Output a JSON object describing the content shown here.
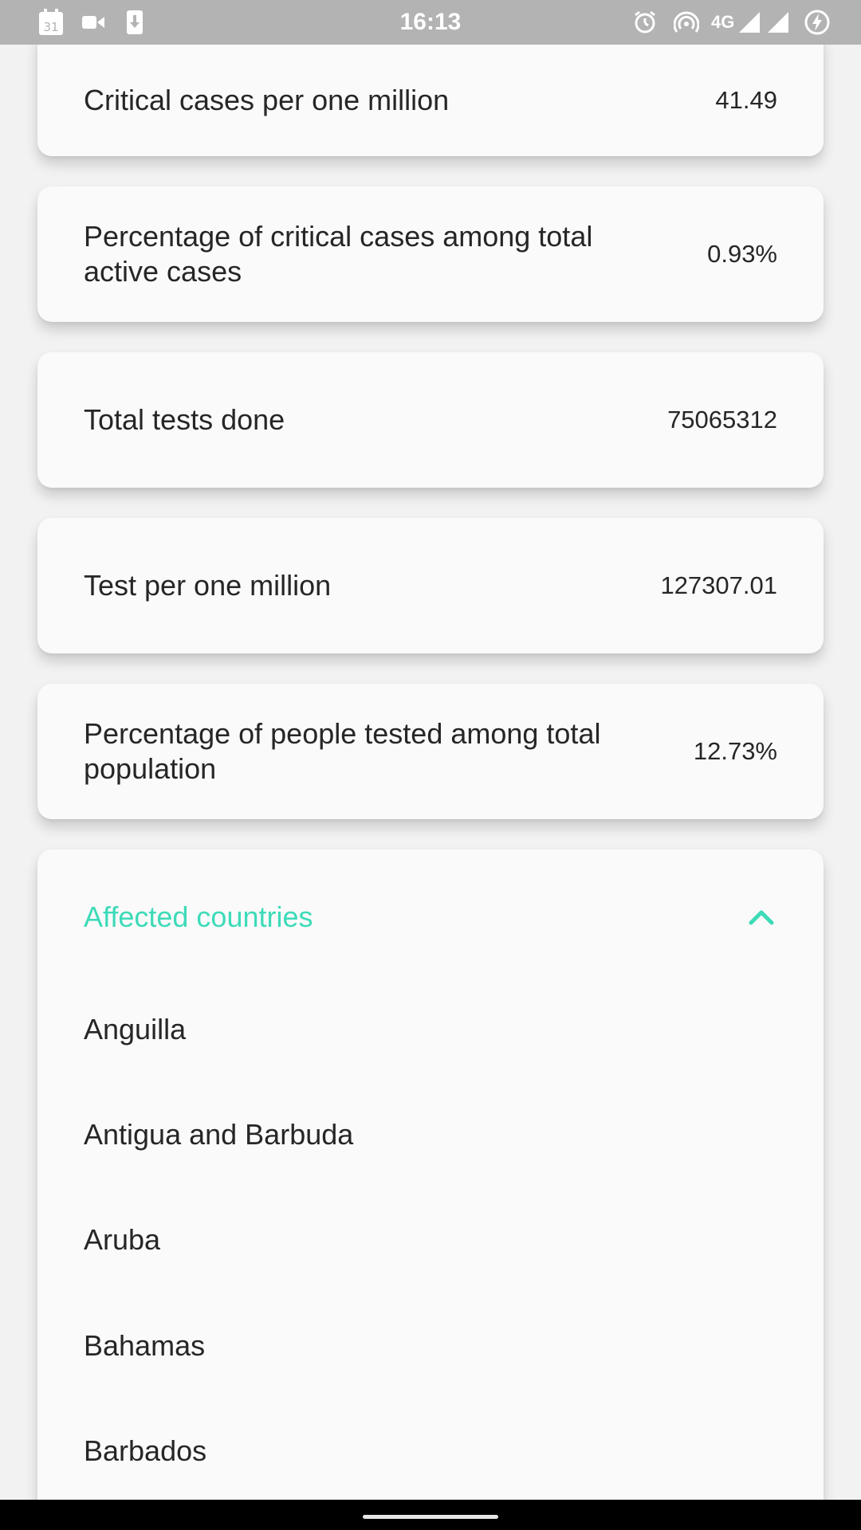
{
  "status_bar": {
    "time": "16:13",
    "network": "4G",
    "calendar_day": "31",
    "icons": [
      "calendar-icon",
      "video-icon",
      "download-icon",
      "alarm-icon",
      "hotspot-icon",
      "signal-icon",
      "signal-icon",
      "battery-charging-icon"
    ]
  },
  "stats": [
    {
      "label": "Critical cases per one million",
      "value": "41.49"
    },
    {
      "label": "Percentage of critical cases among total active cases",
      "value": "0.93%"
    },
    {
      "label": "Total tests done",
      "value": "75065312"
    },
    {
      "label": "Test per one million",
      "value": "127307.01"
    },
    {
      "label": "Percentage of people tested among total population",
      "value": "12.73%"
    }
  ],
  "countries": {
    "title": "Affected countries",
    "expanded": true,
    "accent_color": "#3ddbb8",
    "toggle_icon": "chevron-up-icon",
    "items": [
      "Anguilla",
      "Antigua and Barbuda",
      "Aruba",
      "Bahamas",
      "Barbados"
    ]
  },
  "colors": {
    "status_bar": "#b3b3b3",
    "background": "#f2f2f2",
    "card": "#fafafa",
    "text": "#262626",
    "accent": "#3ddbb8"
  }
}
